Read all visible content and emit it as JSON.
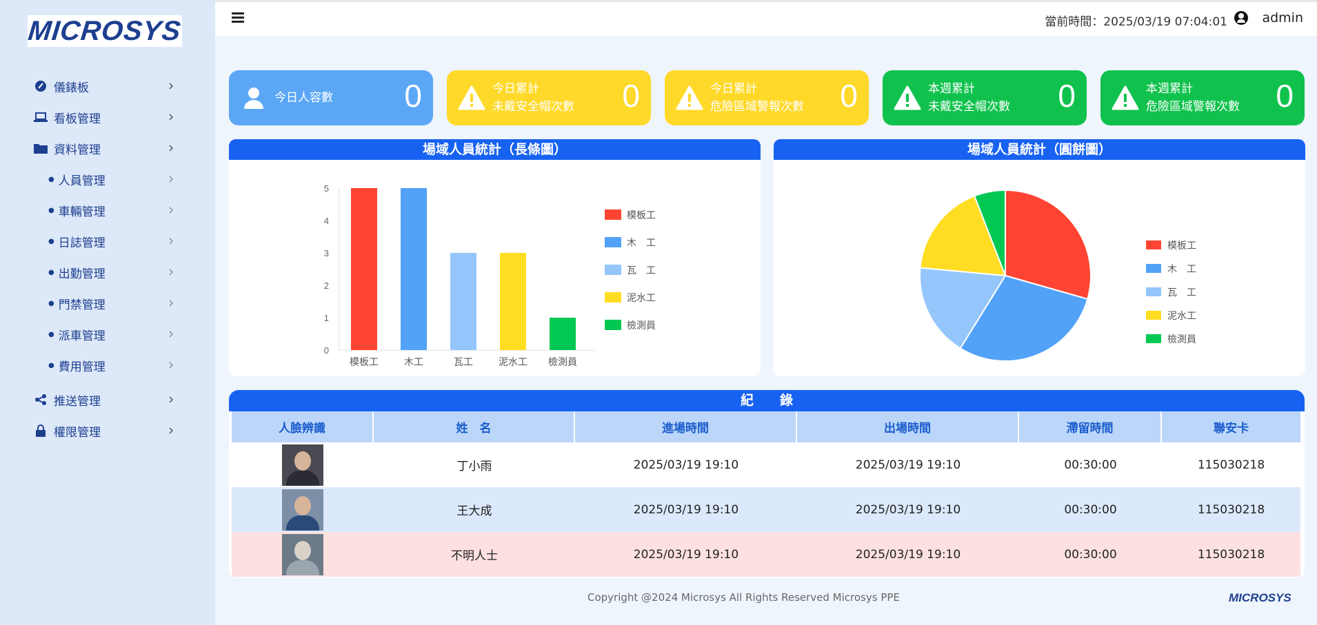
{
  "brand": {
    "name": "MICROSYS"
  },
  "sidebar": {
    "items": [
      {
        "label": "儀錶板",
        "icon": "gauge-icon"
      },
      {
        "label": "看板管理",
        "icon": "laptop-icon"
      },
      {
        "label": "資料管理",
        "icon": "folder-icon"
      },
      {
        "label": "人員管理",
        "sub": true
      },
      {
        "label": "車輛管理",
        "sub": true
      },
      {
        "label": "日誌管理",
        "sub": true
      },
      {
        "label": "出勤管理",
        "sub": true
      },
      {
        "label": "門禁管理",
        "sub": true
      },
      {
        "label": "派車管理",
        "sub": true
      },
      {
        "label": "費用管理",
        "sub": true
      },
      {
        "label": "推送管理",
        "icon": "share-icon"
      },
      {
        "label": "權限管理",
        "icon": "lock-icon"
      }
    ]
  },
  "header": {
    "clock": "當前時間：2025/03/19 07:04:01",
    "user": "admin"
  },
  "cards": [
    {
      "line1": "今日人容數",
      "line2": "",
      "value": "0",
      "color": "#5ba7f6",
      "icon": "user-icon"
    },
    {
      "line1": "今日累計",
      "line2": "未戴安全帽次數",
      "value": "0",
      "color": "#ffd92a",
      "icon": "warning-icon"
    },
    {
      "line1": "今日累計",
      "line2": "危險區域警報次數",
      "value": "0",
      "color": "#ffd92a",
      "icon": "warning-icon"
    },
    {
      "line1": "本週累計",
      "line2": "未戴安全帽次數",
      "value": "0",
      "color": "#10c24d",
      "icon": "warning-icon"
    },
    {
      "line1": "本週累計",
      "line2": "危險區域警報次數",
      "value": "0",
      "color": "#10c24d",
      "icon": "warning-icon"
    }
  ],
  "bar_panel": {
    "title": "場域人員統計（長條圖）"
  },
  "pie_panel": {
    "title": "場域人員統計（圓餅圖）"
  },
  "chart_data": [
    {
      "type": "bar",
      "title": "場域人員統計（長條圖）",
      "categories": [
        "模板工",
        "木工",
        "瓦工",
        "泥水工",
        "檢測員"
      ],
      "values": [
        5,
        5,
        3,
        3,
        1
      ],
      "colors": [
        "#ff4433",
        "#52a2f8",
        "#94c6fb",
        "#ffdd22",
        "#00c853"
      ],
      "legend": [
        "模板工",
        "木　工",
        "瓦　工",
        "泥水工",
        "檢測員"
      ],
      "ylim": [
        0,
        5
      ],
      "yticks": [
        "0",
        "1",
        "2",
        "3",
        "4",
        "5"
      ],
      "legend_position": "right"
    },
    {
      "type": "pie",
      "title": "場域人員統計（圓餅圖）",
      "categories": [
        "模板工",
        "木工",
        "瓦工",
        "泥水工",
        "檢測員"
      ],
      "values": [
        5,
        5,
        3,
        3,
        1
      ],
      "colors": [
        "#ff4433",
        "#52a2f8",
        "#94c6fb",
        "#ffdd22",
        "#00c853"
      ],
      "legend": [
        "模板工",
        "木　工",
        "瓦　工",
        "泥水工",
        "檢測員"
      ],
      "legend_position": "right"
    }
  ],
  "records": {
    "title": "紀　　錄",
    "columns": [
      "人臉辨識",
      "姓　名",
      "進場時間",
      "出場時間",
      "滯留時間",
      "聯安卡"
    ],
    "rows": [
      {
        "name": "丁小雨",
        "in": "2025/03/19 19:10",
        "out": "2025/03/19 19:10",
        "stay": "00:30:00",
        "card": "115030218",
        "bg": "#ffffff"
      },
      {
        "name": "王大成",
        "in": "2025/03/19 19:10",
        "out": "2025/03/19 19:10",
        "stay": "00:30:00",
        "card": "115030218",
        "bg": "#dce9fc"
      },
      {
        "name": "不明人士",
        "in": "2025/03/19 19:10",
        "out": "2025/03/19 19:10",
        "stay": "00:30:00",
        "card": "115030218",
        "bg": "#fde0e0"
      }
    ]
  },
  "footer": {
    "text": "Copyright @2024 Microsys All Rights Reserved Microsys PPE",
    "logo": "MICROSYS"
  }
}
